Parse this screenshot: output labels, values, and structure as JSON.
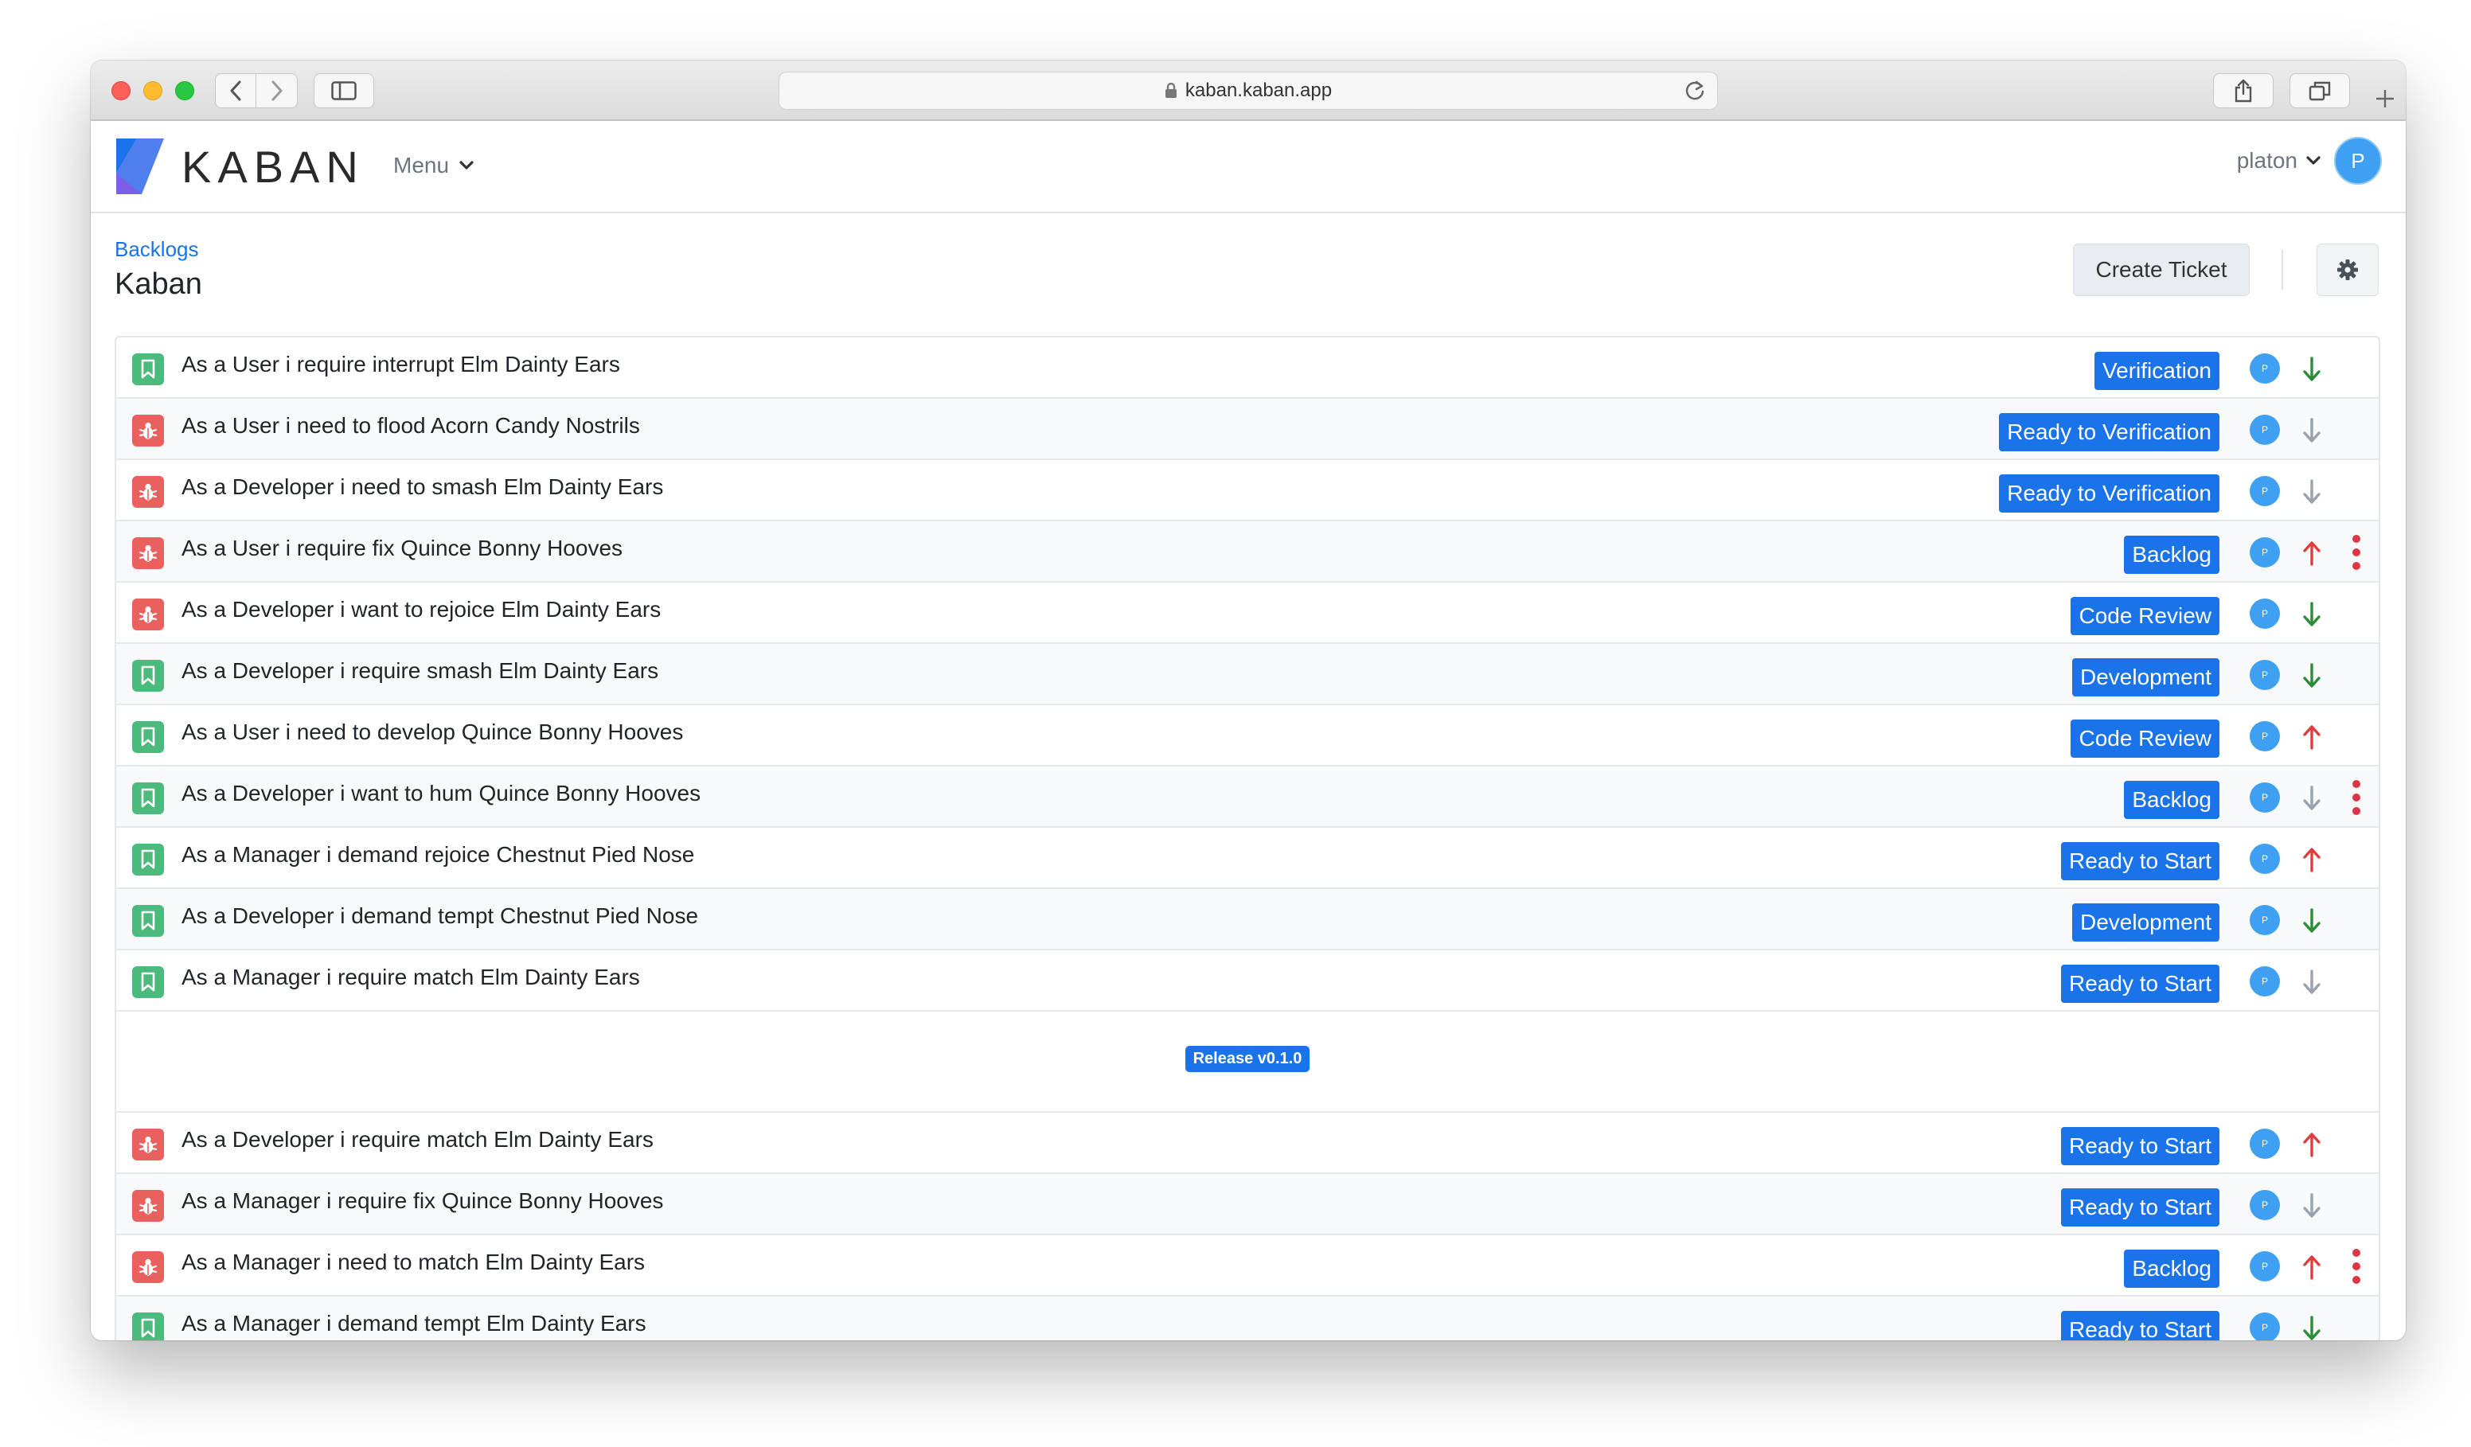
{
  "browser": {
    "url": "kaban.kaban.app"
  },
  "header": {
    "logo_text": "KABAN",
    "menu_label": "Menu",
    "user_name": "platon",
    "user_initial": "P"
  },
  "page": {
    "breadcrumb": "Backlogs",
    "title": "Kaban",
    "create_ticket_label": "Create Ticket"
  },
  "colors": {
    "accent": "#1a73e8",
    "story": "#4cba7c",
    "bug": "#e9605e",
    "priority_high": "#e03e3e",
    "priority_low": "#2e8b3a",
    "priority_none": "#9aa3ad"
  },
  "tickets": [
    {
      "type": "story",
      "title": "As a User i require interrupt Elm Dainty Ears",
      "status": "Verification",
      "assignee": "P",
      "priority": "down-green",
      "menu": false
    },
    {
      "type": "bug",
      "title": "As a User i need to flood Acorn Candy Nostrils",
      "status": "Ready to Verification",
      "assignee": "P",
      "priority": "down-gray",
      "menu": false
    },
    {
      "type": "bug",
      "title": "As a Developer i need to smash Elm Dainty Ears",
      "status": "Ready to Verification",
      "assignee": "P",
      "priority": "down-gray",
      "menu": false
    },
    {
      "type": "bug",
      "title": "As a User i require fix Quince Bonny Hooves",
      "status": "Backlog",
      "assignee": "P",
      "priority": "up-red",
      "menu": true
    },
    {
      "type": "bug",
      "title": "As a Developer i want to rejoice Elm Dainty Ears",
      "status": "Code Review",
      "assignee": "P",
      "priority": "down-green",
      "menu": false
    },
    {
      "type": "story",
      "title": "As a Developer i require smash Elm Dainty Ears",
      "status": "Development",
      "assignee": "P",
      "priority": "down-green",
      "menu": false
    },
    {
      "type": "story",
      "title": "As a User i need to develop Quince Bonny Hooves",
      "status": "Code Review",
      "assignee": "P",
      "priority": "up-red",
      "menu": false
    },
    {
      "type": "story",
      "title": "As a Developer i want to hum Quince Bonny Hooves",
      "status": "Backlog",
      "assignee": "P",
      "priority": "down-gray",
      "menu": true
    },
    {
      "type": "story",
      "title": "As a Manager i demand rejoice Chestnut Pied Nose",
      "status": "Ready to Start",
      "assignee": "P",
      "priority": "up-red",
      "menu": false
    },
    {
      "type": "story",
      "title": "As a Developer i demand tempt Chestnut Pied Nose",
      "status": "Development",
      "assignee": "P",
      "priority": "down-green",
      "menu": false
    },
    {
      "type": "story",
      "title": "As a Manager i require match Elm Dainty Ears",
      "status": "Ready to Start",
      "assignee": "P",
      "priority": "down-gray",
      "menu": false
    }
  ],
  "release": {
    "label": "Release v0.1.0"
  },
  "release_tickets": [
    {
      "type": "bug",
      "title": "As a Developer i require match Elm Dainty Ears",
      "status": "Ready to Start",
      "assignee": "P",
      "priority": "up-red",
      "menu": false
    },
    {
      "type": "bug",
      "title": "As a Manager i require fix Quince Bonny Hooves",
      "status": "Ready to Start",
      "assignee": "P",
      "priority": "down-gray",
      "menu": false
    },
    {
      "type": "bug",
      "title": "As a Manager i need to match Elm Dainty Ears",
      "status": "Backlog",
      "assignee": "P",
      "priority": "up-red",
      "menu": true
    },
    {
      "type": "story",
      "title": "As a Manager i demand tempt Elm Dainty Ears",
      "status": "Ready to Start",
      "assignee": "P",
      "priority": "down-green",
      "menu": false
    }
  ]
}
